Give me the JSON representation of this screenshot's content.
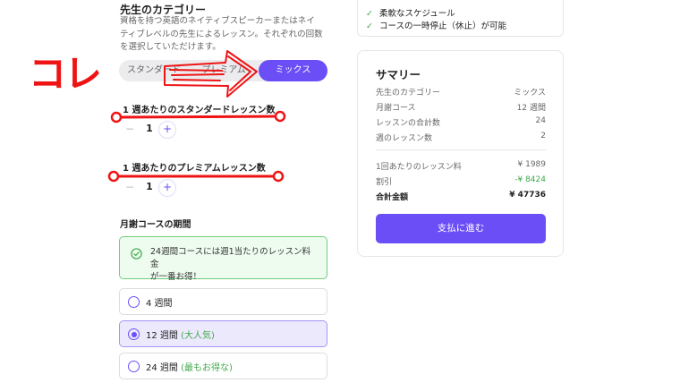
{
  "teacher": {
    "title": "先生のカテゴリー",
    "description_lines": [
      "資格を持つ英語のネイティブスピーカーまたはネイ",
      "ティブレベルの先生によるレッスン。それぞれの回数",
      "を選択していただけます。"
    ],
    "options": [
      "スタンダード",
      "プレミアム",
      "ミックス"
    ],
    "selected": "ミックス"
  },
  "standard_count": {
    "label": "1 週あたりのスタンダードレッスン数",
    "minus": "−",
    "value": "1",
    "plus": "+"
  },
  "premium_count": {
    "label": "1 週あたりのプレミアムレッスン数",
    "minus": "−",
    "value": "1",
    "plus": "+"
  },
  "period": {
    "label": "月謝コースの期間",
    "info_lines": [
      "24週間コースには週1当たりのレッスン料金",
      "が一番お得！"
    ],
    "options": [
      {
        "label": "4 週間",
        "badge": ""
      },
      {
        "label": "12 週間",
        "badge": "(大人気)"
      },
      {
        "label": "24 週間",
        "badge": "(最もお得な)"
      }
    ],
    "selected_index": 1
  },
  "features": [
    "柔軟なスケジュール",
    "コースの一時停止（休止）が可能"
  ],
  "summary": {
    "title": "サマリー",
    "rows": [
      {
        "label": "先生のカテゴリー",
        "value": "ミックス"
      },
      {
        "label": "月謝コース",
        "value": "12 週間"
      },
      {
        "label": "レッスンの合計数",
        "value": "24"
      },
      {
        "label": "週のレッスン数",
        "value": "2"
      }
    ],
    "price_per_lesson": {
      "label": "1回あたりのレッスン料",
      "value": "¥ 1989"
    },
    "discount": {
      "label": "割引",
      "value": "-¥ 8424"
    },
    "total": {
      "label": "合計金額",
      "value": "¥ 47736"
    },
    "pay_button": "支払に進む"
  },
  "annotation": {
    "text": "コレ"
  },
  "colors": {
    "accent": "#6b4ef6",
    "success": "#3fa84b",
    "annotation": "#ef1414"
  },
  "icons": [
    "check-icon",
    "check-circle-icon",
    "radio-icon",
    "arrow-annotation"
  ]
}
